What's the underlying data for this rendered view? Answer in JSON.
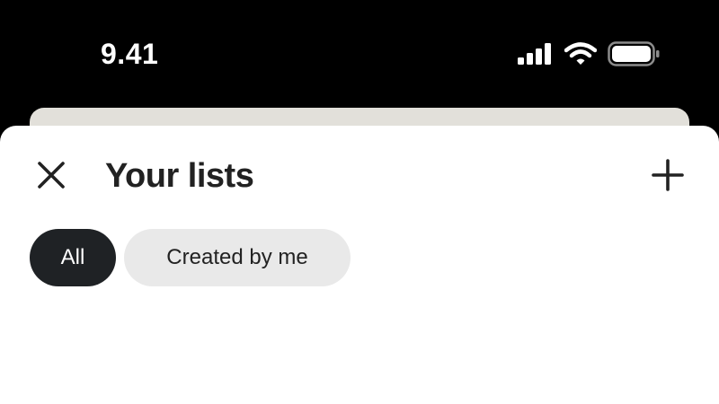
{
  "status_bar": {
    "time": "9.41",
    "icons": [
      "signal-icon",
      "wifi-icon",
      "battery-icon"
    ]
  },
  "sheet": {
    "title": "Your lists",
    "close_icon": "close-icon",
    "add_icon": "plus-icon"
  },
  "filters": {
    "chips": [
      {
        "label": "All",
        "selected": true
      },
      {
        "label": "Created by me",
        "selected": false
      }
    ]
  },
  "colors": {
    "background": "#000000",
    "sheet": "#ffffff",
    "back_card": "#e2e0da",
    "chip_active_bg": "#1f2225",
    "chip_inactive_bg": "#e9e9e9",
    "text_primary": "#222222"
  }
}
